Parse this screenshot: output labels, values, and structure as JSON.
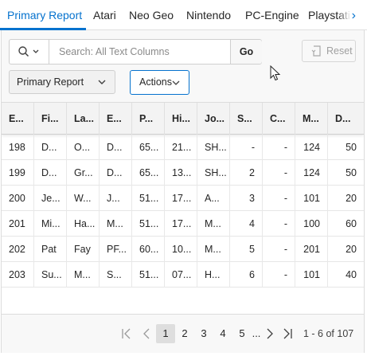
{
  "tabs": {
    "items": [
      "Primary Report",
      "Atari",
      "Neo Geo",
      "Nintendo",
      "PC-Engine",
      "Playstation"
    ],
    "active_index": 0,
    "next_icon": "chevron-right-icon"
  },
  "toolbar": {
    "search_placeholder": "Search: All Text Columns",
    "search_icon": "search-icon",
    "go_label": "Go",
    "reset_label": "Reset",
    "report_select_value": "Primary Report",
    "actions_label": "Actions"
  },
  "grid": {
    "columns": [
      "E...",
      "Fi...",
      "La...",
      "E...",
      "P...",
      "Hi...",
      "Jo...",
      "S...",
      "C...",
      "M...",
      "D..."
    ],
    "rows": [
      [
        "198",
        "D...",
        "O...",
        "D...",
        "65...",
        "21...",
        "SH...",
        "-",
        "-",
        "124",
        "50"
      ],
      [
        "199",
        "D...",
        "Gr...",
        "D...",
        "65...",
        "13...",
        "SH...",
        "2",
        "-",
        "124",
        "50"
      ],
      [
        "200",
        "Je...",
        "W...",
        "J...",
        "51...",
        "17...",
        "A...",
        "3",
        "-",
        "101",
        "20"
      ],
      [
        "201",
        "Mi...",
        "Ha...",
        "M...",
        "51...",
        "17...",
        "M...",
        "4",
        "-",
        "100",
        "60"
      ],
      [
        "202",
        "Pat",
        "Fay",
        "PF...",
        "60...",
        "10...",
        "M...",
        "5",
        "-",
        "201",
        "20"
      ],
      [
        "203",
        "Su...",
        "M...",
        "S...",
        "51...",
        "07...",
        "H...",
        "6",
        "-",
        "101",
        "40"
      ]
    ]
  },
  "pagination": {
    "pages": [
      "1",
      "2",
      "3",
      "4",
      "5",
      "..."
    ],
    "current_page": "1",
    "range_text": "1 - 6 of 107"
  },
  "colors": {
    "accent": "#0572ce",
    "muted": "#9a9a9a"
  }
}
